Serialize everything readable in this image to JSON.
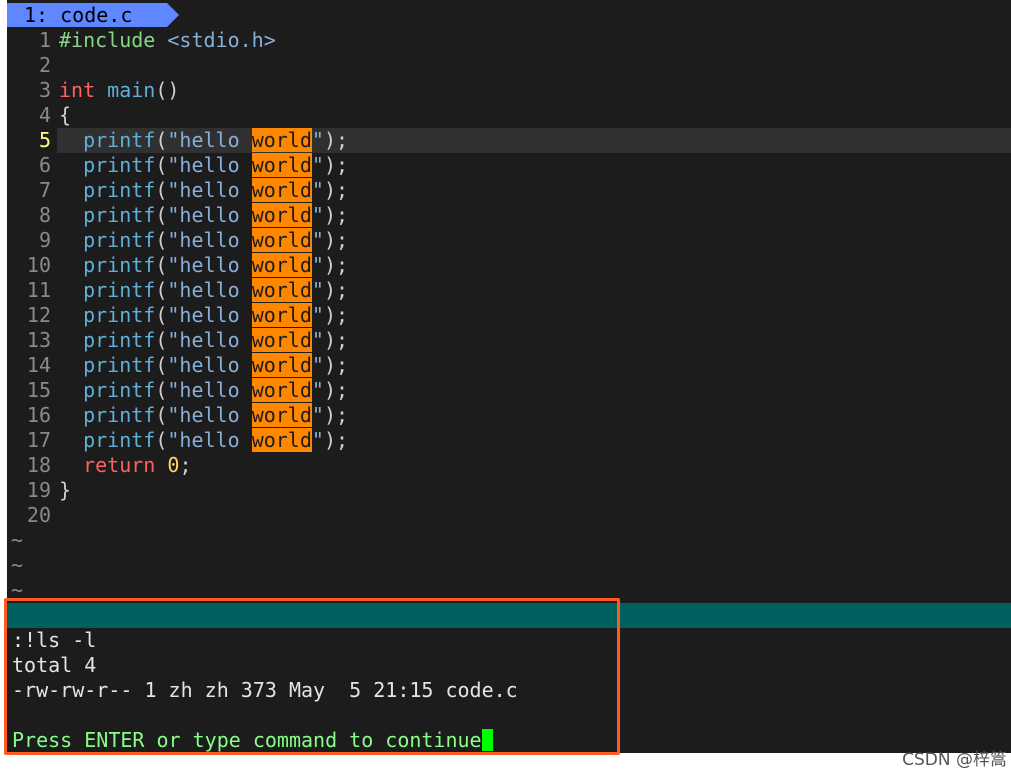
{
  "tab": {
    "label": "1: code.c"
  },
  "editor": {
    "current_line": 5,
    "lines": [
      {
        "num": "1",
        "tokens": [
          {
            "t": "#include ",
            "c": "pp"
          },
          {
            "t": "<stdio.h>",
            "c": "inc"
          }
        ]
      },
      {
        "num": "2",
        "tokens": []
      },
      {
        "num": "3",
        "tokens": [
          {
            "t": "int",
            "c": "kw"
          },
          {
            "t": " ",
            "c": "punc"
          },
          {
            "t": "main",
            "c": "fn"
          },
          {
            "t": "()",
            "c": "punc"
          }
        ]
      },
      {
        "num": "4",
        "tokens": [
          {
            "t": "{",
            "c": "punc"
          }
        ]
      },
      {
        "num": "5",
        "tokens": [
          {
            "t": "  ",
            "c": "punc"
          },
          {
            "t": "printf",
            "c": "fn"
          },
          {
            "t": "(",
            "c": "punc"
          },
          {
            "t": "\"hello ",
            "c": "str"
          },
          {
            "t": "world",
            "c": "hl"
          },
          {
            "t": "\"",
            "c": "str"
          },
          {
            "t": ");",
            "c": "punc"
          }
        ]
      },
      {
        "num": "6",
        "tokens": [
          {
            "t": "  ",
            "c": "punc"
          },
          {
            "t": "printf",
            "c": "fn"
          },
          {
            "t": "(",
            "c": "punc"
          },
          {
            "t": "\"hello ",
            "c": "str"
          },
          {
            "t": "world",
            "c": "hl"
          },
          {
            "t": "\"",
            "c": "str"
          },
          {
            "t": ");",
            "c": "punc"
          }
        ]
      },
      {
        "num": "7",
        "tokens": [
          {
            "t": "  ",
            "c": "punc"
          },
          {
            "t": "printf",
            "c": "fn"
          },
          {
            "t": "(",
            "c": "punc"
          },
          {
            "t": "\"hello ",
            "c": "str"
          },
          {
            "t": "world",
            "c": "hl"
          },
          {
            "t": "\"",
            "c": "str"
          },
          {
            "t": ");",
            "c": "punc"
          }
        ]
      },
      {
        "num": "8",
        "tokens": [
          {
            "t": "  ",
            "c": "punc"
          },
          {
            "t": "printf",
            "c": "fn"
          },
          {
            "t": "(",
            "c": "punc"
          },
          {
            "t": "\"hello ",
            "c": "str"
          },
          {
            "t": "world",
            "c": "hl"
          },
          {
            "t": "\"",
            "c": "str"
          },
          {
            "t": ");",
            "c": "punc"
          }
        ]
      },
      {
        "num": "9",
        "tokens": [
          {
            "t": "  ",
            "c": "punc"
          },
          {
            "t": "printf",
            "c": "fn"
          },
          {
            "t": "(",
            "c": "punc"
          },
          {
            "t": "\"hello ",
            "c": "str"
          },
          {
            "t": "world",
            "c": "hl"
          },
          {
            "t": "\"",
            "c": "str"
          },
          {
            "t": ");",
            "c": "punc"
          }
        ]
      },
      {
        "num": "10",
        "tokens": [
          {
            "t": "  ",
            "c": "punc"
          },
          {
            "t": "printf",
            "c": "fn"
          },
          {
            "t": "(",
            "c": "punc"
          },
          {
            "t": "\"hello ",
            "c": "str"
          },
          {
            "t": "world",
            "c": "hl"
          },
          {
            "t": "\"",
            "c": "str"
          },
          {
            "t": ");",
            "c": "punc"
          }
        ]
      },
      {
        "num": "11",
        "tokens": [
          {
            "t": "  ",
            "c": "punc"
          },
          {
            "t": "printf",
            "c": "fn"
          },
          {
            "t": "(",
            "c": "punc"
          },
          {
            "t": "\"hello ",
            "c": "str"
          },
          {
            "t": "world",
            "c": "hl"
          },
          {
            "t": "\"",
            "c": "str"
          },
          {
            "t": ");",
            "c": "punc"
          }
        ]
      },
      {
        "num": "12",
        "tokens": [
          {
            "t": "  ",
            "c": "punc"
          },
          {
            "t": "printf",
            "c": "fn"
          },
          {
            "t": "(",
            "c": "punc"
          },
          {
            "t": "\"hello ",
            "c": "str"
          },
          {
            "t": "world",
            "c": "hl"
          },
          {
            "t": "\"",
            "c": "str"
          },
          {
            "t": ");",
            "c": "punc"
          }
        ]
      },
      {
        "num": "13",
        "tokens": [
          {
            "t": "  ",
            "c": "punc"
          },
          {
            "t": "printf",
            "c": "fn"
          },
          {
            "t": "(",
            "c": "punc"
          },
          {
            "t": "\"hello ",
            "c": "str"
          },
          {
            "t": "world",
            "c": "hl"
          },
          {
            "t": "\"",
            "c": "str"
          },
          {
            "t": ");",
            "c": "punc"
          }
        ]
      },
      {
        "num": "14",
        "tokens": [
          {
            "t": "  ",
            "c": "punc"
          },
          {
            "t": "printf",
            "c": "fn"
          },
          {
            "t": "(",
            "c": "punc"
          },
          {
            "t": "\"hello ",
            "c": "str"
          },
          {
            "t": "world",
            "c": "hl"
          },
          {
            "t": "\"",
            "c": "str"
          },
          {
            "t": ");",
            "c": "punc"
          }
        ]
      },
      {
        "num": "15",
        "tokens": [
          {
            "t": "  ",
            "c": "punc"
          },
          {
            "t": "printf",
            "c": "fn"
          },
          {
            "t": "(",
            "c": "punc"
          },
          {
            "t": "\"hello ",
            "c": "str"
          },
          {
            "t": "world",
            "c": "hl"
          },
          {
            "t": "\"",
            "c": "str"
          },
          {
            "t": ");",
            "c": "punc"
          }
        ]
      },
      {
        "num": "16",
        "tokens": [
          {
            "t": "  ",
            "c": "punc"
          },
          {
            "t": "printf",
            "c": "fn"
          },
          {
            "t": "(",
            "c": "punc"
          },
          {
            "t": "\"hello ",
            "c": "str"
          },
          {
            "t": "world",
            "c": "hl"
          },
          {
            "t": "\"",
            "c": "str"
          },
          {
            "t": ");",
            "c": "punc"
          }
        ]
      },
      {
        "num": "17",
        "tokens": [
          {
            "t": "  ",
            "c": "punc"
          },
          {
            "t": "printf",
            "c": "fn"
          },
          {
            "t": "(",
            "c": "punc"
          },
          {
            "t": "\"hello ",
            "c": "str"
          },
          {
            "t": "world",
            "c": "hl"
          },
          {
            "t": "\"",
            "c": "str"
          },
          {
            "t": ");",
            "c": "punc"
          }
        ]
      },
      {
        "num": "18",
        "tokens": [
          {
            "t": "  ",
            "c": "punc"
          },
          {
            "t": "return",
            "c": "kw"
          },
          {
            "t": " ",
            "c": "punc"
          },
          {
            "t": "0",
            "c": "num"
          },
          {
            "t": ";",
            "c": "punc"
          }
        ]
      },
      {
        "num": "19",
        "tokens": [
          {
            "t": "}",
            "c": "punc"
          }
        ]
      },
      {
        "num": "20",
        "tokens": []
      }
    ],
    "tilde_rows": [
      "~",
      "~",
      "~"
    ]
  },
  "command_output": {
    "command": ":!ls -l",
    "total": "total 4",
    "listing": "-rw-rw-r-- 1 zh zh 373 May  5 21:15 code.c",
    "blank": "",
    "prompt": "Press ENTER or type command to continue"
  },
  "watermark": "CSDN @梓篙",
  "colors": {
    "tab_bg": "#5f87ff",
    "status_bar": "#005f5f",
    "search_highlight": "#ff8700",
    "annotation_box": "#ff5a1f",
    "cursor": "#00ff00"
  }
}
